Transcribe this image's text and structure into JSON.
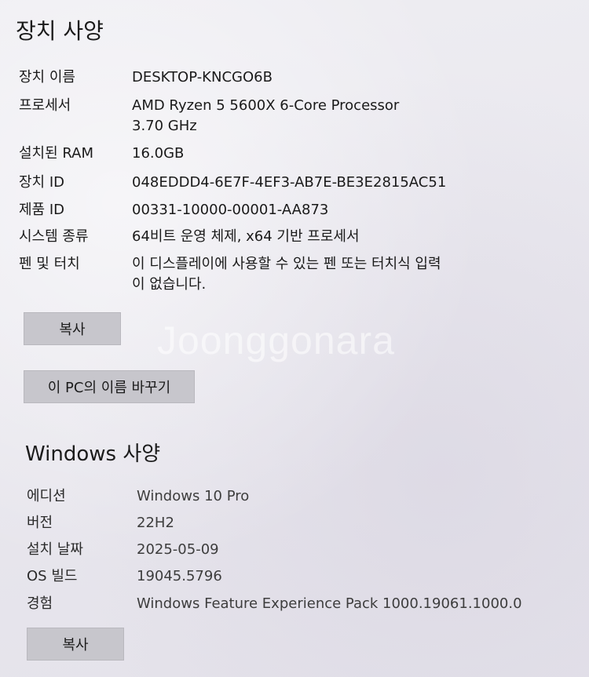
{
  "device_specs": {
    "title": "장치 사양",
    "rows": [
      {
        "label": "장치 이름",
        "value": "DESKTOP-KNCGO6B"
      },
      {
        "label": "프로세서",
        "value": "AMD Ryzen 5 5600X 6-Core Processor",
        "value2": "3.70 GHz"
      },
      {
        "label": "설치된 RAM",
        "value": "16.0GB"
      },
      {
        "label": "장치 ID",
        "value": "048EDDD4-6E7F-4EF3-AB7E-BE3E2815AC51"
      },
      {
        "label": "제품 ID",
        "value": "00331-10000-00001-AA873"
      },
      {
        "label": "시스템 종류",
        "value": "64비트 운영 체제, x64 기반 프로세서"
      },
      {
        "label": "펜 및 터치",
        "value": "이 디스플레이에 사용할 수 있는 펜 또는 터치식 입력",
        "value2": "이 없습니다."
      }
    ],
    "copy_button": "복사",
    "rename_button": "이 PC의 이름 바꾸기"
  },
  "windows_specs": {
    "title": "Windows 사양",
    "rows": [
      {
        "label": "에디션",
        "value": "Windows 10 Pro"
      },
      {
        "label": "버전",
        "value": "22H2"
      },
      {
        "label": "설치 날짜",
        "value": "2025-05-09"
      },
      {
        "label": "OS 빌드",
        "value": "19045.5796"
      },
      {
        "label": "경험",
        "value": "Windows Feature Experience Pack 1000.19061.1000.0"
      }
    ],
    "copy_button": "복사"
  },
  "watermark": "Joonggonara"
}
